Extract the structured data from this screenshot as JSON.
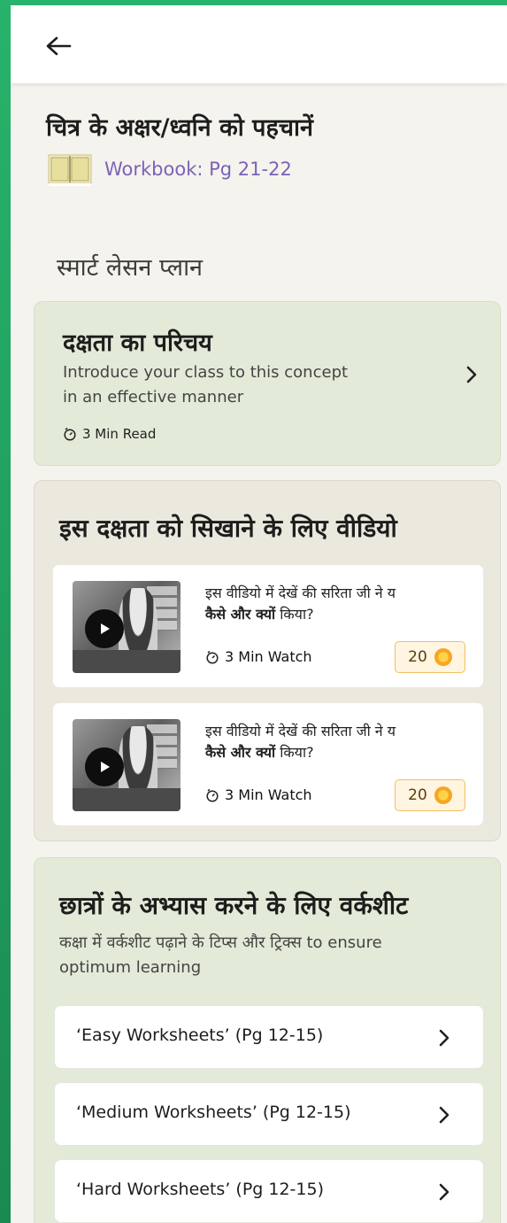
{
  "header": {
    "back_icon": "arrow-left-icon"
  },
  "page": {
    "title": "चित्र के अक्षर/ध्वनि को पहचानें",
    "workbook_icon": "open-book-icon",
    "workbook_label": "Workbook: Pg 21-22",
    "section_heading": "स्मार्ट लेसन प्लान"
  },
  "intro_card": {
    "title": "दक्षता का परिचय",
    "description": "Introduce your class to this concept in an effective manner",
    "meta": "3 Min Read"
  },
  "videos_card": {
    "title": "इस दक्षता को सिखाने के लिए वीडियो",
    "items": [
      {
        "text_line1": "इस वीडियो में देखें की सरिता जी ने य",
        "text_bold": "कैसे और क्यों",
        "text_rest": " किया?",
        "meta": "3 Min Watch",
        "coins": "20"
      },
      {
        "text_line1": "इस वीडियो में देखें की सरिता जी ने य",
        "text_bold": "कैसे और क्यों",
        "text_rest": " किया?",
        "meta": "3 Min Watch",
        "coins": "20"
      }
    ]
  },
  "worksheets_card": {
    "title": "छात्रों के अभ्यास करने के लिए वर्कशीट",
    "description": "कक्षा में वर्कशीट पढ़ाने के टिप्स और ट्रिक्स to ensure optimum learning",
    "items": [
      {
        "label": "‘Easy Worksheets’ (Pg 12-15)"
      },
      {
        "label": "‘Medium Worksheets’ (Pg 12-15)"
      },
      {
        "label": "‘Hard Worksheets’ (Pg 12-15)"
      }
    ]
  },
  "colors": {
    "accent_purple": "#7b63b6",
    "card_green": "#e3ebd8",
    "card_beige": "#ebe8de",
    "coin_border": "#f0c060"
  }
}
